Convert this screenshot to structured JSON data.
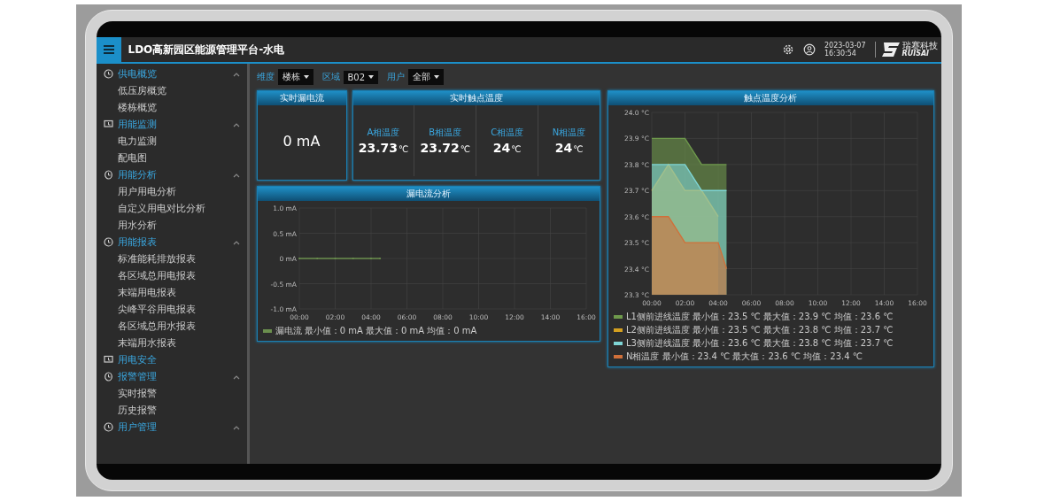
{
  "header": {
    "title": "LDO高新园区能源管理平台-水电",
    "date": "2023-03-07",
    "time": "16:30:54",
    "logo": {
      "name": "瑞赛科技",
      "latin": "RUISAI"
    }
  },
  "sidebar": {
    "items": [
      {
        "label": "供电概览",
        "kind": "group",
        "expanded": true,
        "children": [
          {
            "label": "低压房概览"
          },
          {
            "label": "楼栋概览"
          }
        ]
      },
      {
        "label": "用能监测",
        "kind": "group",
        "expanded": true,
        "children": [
          {
            "label": "电力监测"
          },
          {
            "label": "配电图"
          }
        ]
      },
      {
        "label": "用能分析",
        "kind": "group",
        "expanded": true,
        "children": [
          {
            "label": "用户用电分析"
          },
          {
            "label": "自定义用电对比分析"
          },
          {
            "label": "用水分析"
          }
        ]
      },
      {
        "label": "用能报表",
        "kind": "group",
        "expanded": true,
        "children": [
          {
            "label": "标准能耗排放报表"
          },
          {
            "label": "各区域总用电报表"
          },
          {
            "label": "末端用电报表"
          },
          {
            "label": "尖峰平谷用电报表"
          },
          {
            "label": "各区域总用水报表"
          },
          {
            "label": "末端用水报表"
          }
        ]
      },
      {
        "label": "用电安全",
        "kind": "link"
      },
      {
        "label": "报警管理",
        "kind": "group",
        "expanded": true,
        "children": [
          {
            "label": "实时报警"
          },
          {
            "label": "历史报警"
          }
        ]
      },
      {
        "label": "用户管理",
        "kind": "group",
        "expanded": true
      }
    ]
  },
  "filters": [
    {
      "label": "维度",
      "value": "楼栋"
    },
    {
      "label": "区域",
      "value": "B02"
    },
    {
      "label": "用户",
      "value": "全部"
    }
  ],
  "leakage_panel": {
    "title": "实时漏电流",
    "value": "0 mA"
  },
  "temperature_panel": {
    "title": "实时触点温度",
    "readings": [
      {
        "label": "A相温度",
        "value": "23.73",
        "unit": "℃"
      },
      {
        "label": "B相温度",
        "value": "23.72",
        "unit": "℃"
      },
      {
        "label": "C相温度",
        "value": "24",
        "unit": "℃"
      },
      {
        "label": "N相温度",
        "value": "24",
        "unit": "℃"
      }
    ]
  },
  "leakage_chart": {
    "title": "漏电流分析",
    "legend": [
      "最小值：0 mA 最大值：0 mA 均值：0 mA"
    ],
    "chart_data": {
      "type": "line",
      "grid": true,
      "x": [
        0,
        1,
        2,
        3,
        4,
        4.5
      ],
      "xlim": [
        0,
        16
      ],
      "ylim": [
        -1,
        1
      ],
      "xticks": [
        {
          "value": 0,
          "label": "00:00"
        },
        {
          "value": 2,
          "label": "02:00"
        },
        {
          "value": 4,
          "label": "04:00"
        },
        {
          "value": 6,
          "label": "06:00"
        },
        {
          "value": 8,
          "label": "08:00"
        },
        {
          "value": 10,
          "label": "10:00"
        },
        {
          "value": 12,
          "label": "12:00"
        },
        {
          "value": 14,
          "label": "14:00"
        },
        {
          "value": 16,
          "label": "16:00"
        }
      ],
      "yticks": [
        {
          "value": 1,
          "label": "1.0 mA"
        },
        {
          "value": 0.5,
          "label": "0.5 mA"
        },
        {
          "value": 0,
          "label": "0 mA"
        },
        {
          "value": -0.5,
          "label": "-0.5 mA"
        },
        {
          "value": -1,
          "label": "-1.0 mA"
        }
      ],
      "series": [
        {
          "name": "漏电流",
          "color": "#6b8f4e",
          "values": [
            0,
            0,
            0,
            0,
            0,
            0
          ]
        }
      ]
    }
  },
  "temperature_chart": {
    "title": "触点温度分析",
    "legend": [
      "最小值：23.5 ℃ 最大值：23.9 ℃ 均值：23.6 ℃",
      "最小值：23.5 ℃ 最大值：23.8 ℃ 均值：23.7 ℃",
      "最小值：23.6 ℃ 最大值：23.8 ℃ 均值：23.7 ℃",
      "最小值：23.4 ℃ 最大值：23.6 ℃ 均值：23.4 ℃"
    ],
    "chart_data": {
      "type": "area",
      "grid": true,
      "x": [
        0,
        1,
        2,
        3,
        4,
        4.5
      ],
      "xlim": [
        0,
        16
      ],
      "ylim": [
        23.3,
        24
      ],
      "xticks": [
        {
          "value": 0,
          "label": "00:00"
        },
        {
          "value": 2,
          "label": "02:00"
        },
        {
          "value": 4,
          "label": "04:00"
        },
        {
          "value": 6,
          "label": "06:00"
        },
        {
          "value": 8,
          "label": "08:00"
        },
        {
          "value": 10,
          "label": "10:00"
        },
        {
          "value": 12,
          "label": "12:00"
        },
        {
          "value": 14,
          "label": "14:00"
        },
        {
          "value": 16,
          "label": "16:00"
        }
      ],
      "yticks": [
        {
          "value": 24,
          "label": "24.0 °C"
        },
        {
          "value": 23.9,
          "label": "23.9 °C"
        },
        {
          "value": 23.8,
          "label": "23.8 °C"
        },
        {
          "value": 23.7,
          "label": "23.7 °C"
        },
        {
          "value": 23.6,
          "label": "23.6 °C"
        },
        {
          "value": 23.5,
          "label": "23.5 °C"
        },
        {
          "value": 23.4,
          "label": "23.4 °C"
        },
        {
          "value": 23.3,
          "label": "23.3 °C"
        }
      ],
      "series": [
        {
          "name": "L1侧前进线温度",
          "color": "#6f9a4c",
          "values": [
            23.9,
            23.9,
            23.9,
            23.8,
            23.8,
            23.8
          ]
        },
        {
          "name": "L2侧前进线温度",
          "color": "#d4a020",
          "values": [
            23.7,
            23.8,
            23.7,
            23.7,
            23.6,
            null
          ]
        },
        {
          "name": "L3侧前进线温度",
          "color": "#7fd6d6",
          "values": [
            23.8,
            23.8,
            23.8,
            23.7,
            23.7,
            23.7
          ]
        },
        {
          "name": "N相温度",
          "color": "#d0703a",
          "values": [
            23.6,
            23.6,
            23.5,
            23.5,
            23.5,
            23.4
          ]
        }
      ]
    }
  }
}
